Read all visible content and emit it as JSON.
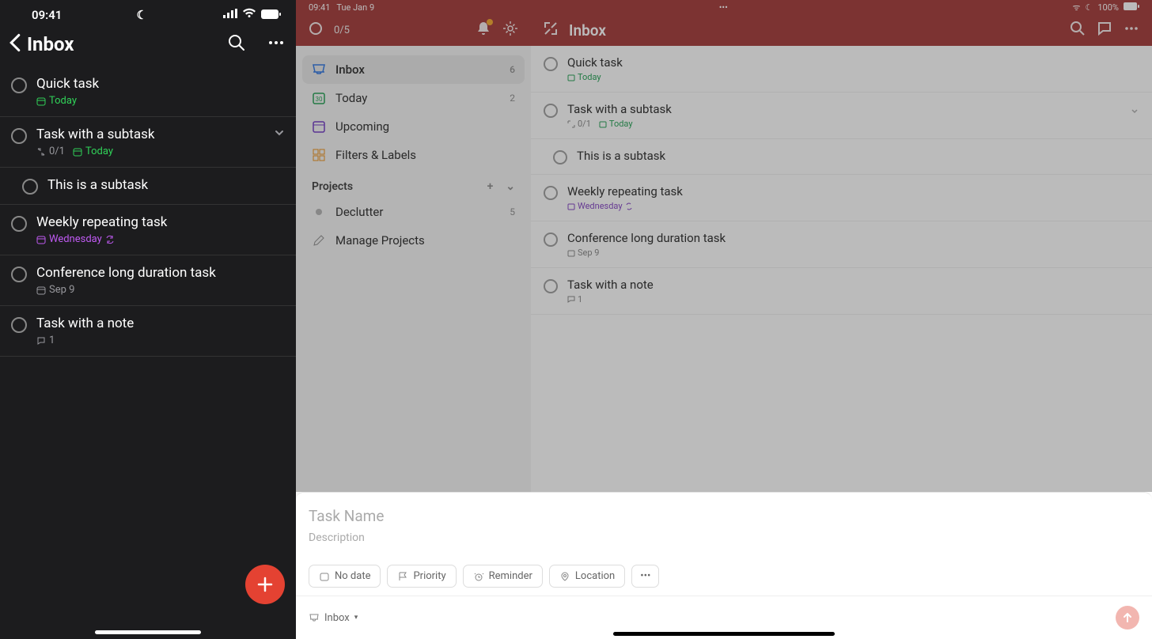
{
  "phone": {
    "status": {
      "time": "09:41"
    },
    "header": {
      "title": "Inbox"
    },
    "tasks": [
      {
        "title": "Quick task",
        "meta_today": "Today"
      },
      {
        "title": "Task with a subtask",
        "sub_count": "0/1",
        "meta_today": "Today",
        "subtasks": [
          {
            "title": "This is a subtask"
          }
        ]
      },
      {
        "title": "Weekly repeating task",
        "meta_wed": "Wednesday"
      },
      {
        "title": "Conference long duration task",
        "meta_date": "Sep 9"
      },
      {
        "title": "Task with a note",
        "comment_count": "1"
      }
    ]
  },
  "tablet": {
    "status": {
      "time": "09:41",
      "date": "Tue Jan 9",
      "battery": "100%"
    },
    "topbar": {
      "progress": "0/5",
      "title": "Inbox"
    },
    "sidebar": {
      "items": [
        {
          "label": "Inbox",
          "count": "6"
        },
        {
          "label": "Today",
          "count": "2"
        },
        {
          "label": "Upcoming"
        },
        {
          "label": "Filters & Labels"
        }
      ],
      "section": "Projects",
      "projects": [
        {
          "label": "Declutter",
          "count": "5"
        }
      ],
      "manage": "Manage Projects"
    },
    "tasks": [
      {
        "title": "Quick task",
        "meta_today": "Today"
      },
      {
        "title": "Task with a subtask",
        "sub_count": "0/1",
        "meta_today": "Today",
        "subtasks": [
          {
            "title": "This is a subtask"
          }
        ]
      },
      {
        "title": "Weekly repeating task",
        "meta_wed": "Wednesday"
      },
      {
        "title": "Conference long duration task",
        "meta_date": "Sep 9"
      },
      {
        "title": "Task with a note",
        "comment_count": "1"
      }
    ],
    "compose": {
      "name_placeholder": "Task Name",
      "desc_placeholder": "Description",
      "pills": {
        "no_date": "No date",
        "priority": "Priority",
        "reminder": "Reminder",
        "location": "Location"
      },
      "project": "Inbox"
    }
  }
}
